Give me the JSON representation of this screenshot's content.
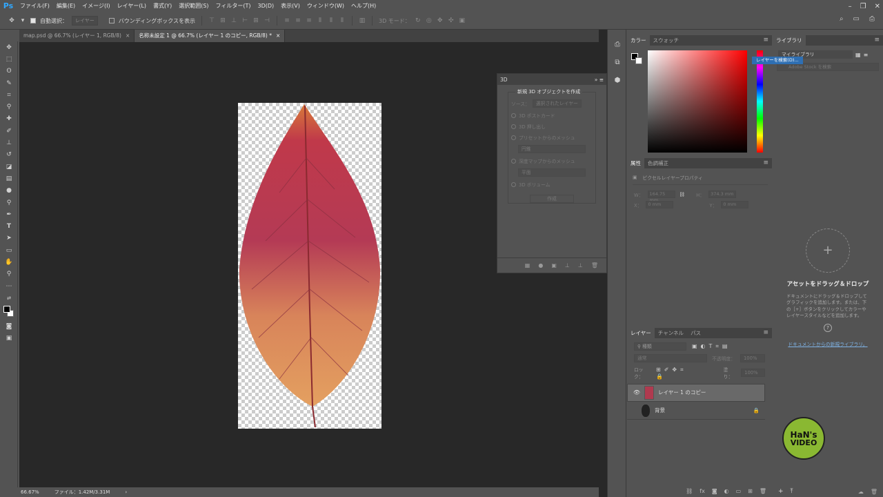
{
  "app": {
    "logo": "Ps"
  },
  "menus": [
    "ファイル(F)",
    "編集(E)",
    "イメージ(I)",
    "レイヤー(L)",
    "書式(Y)",
    "選択範囲(S)",
    "フィルター(T)",
    "3D(D)",
    "表示(V)",
    "ウィンドウ(W)",
    "ヘルプ(H)"
  ],
  "options": {
    "auto_select_label": "自動選択：",
    "auto_select_value": "レイヤー",
    "bbox_label": "バウンディングボックスを表示",
    "mode3d_label": "3D モード："
  },
  "tabs": [
    {
      "label": "map.psd @ 66.7% (レイヤー 1, RGB/8)",
      "close": "×"
    },
    {
      "label": "名称未設定 1 @ 66.7% (レイヤー 1 のコピー, RGB/8) *",
      "close": "×"
    }
  ],
  "status": {
    "zoom": "66.67%",
    "file": "ファイル：1.42M/3.31M",
    "arrow": "›"
  },
  "panel3d": {
    "title": "3D",
    "heading": "新規 3D オブジェクトを作成",
    "source_label": "ソース：",
    "source_value": "選択されたレイヤー",
    "opt1": "3D ポストカード",
    "opt2": "3D 押し出し",
    "opt3": "プリセットからのメッシュ",
    "opt3_value": "円錐",
    "opt4": "深度マップからのメッシュ",
    "opt4_value": "平面",
    "opt5": "3D ボリューム",
    "create": "作成"
  },
  "color_panel": {
    "tab_color": "カラー",
    "tab_swatch": "スウォッチ",
    "fg_color": "#000000",
    "bg_color": "#ffffff",
    "hue_color": "#ff0000"
  },
  "props_panel": {
    "tab_props": "属性",
    "tab_adjust": "色調補正",
    "title": "ピクセルレイヤープロパティ",
    "w_label": "W：",
    "w_value": "164.75 mm",
    "h_label": "H：",
    "h_value": "374.3 mm",
    "x_label": "X：",
    "x_value": "0 mm",
    "y_label": "Y：",
    "y_value": "0 mm"
  },
  "layers_panel": {
    "tab_layers": "レイヤー",
    "tab_channels": "チャンネル",
    "tab_paths": "パス",
    "kind": "種類",
    "blend": "通常",
    "opacity_label": "不透明度：",
    "opacity_value": "100%",
    "lock_label": "ロック：",
    "fill_label": "塗り：",
    "fill_value": "100%",
    "layers": [
      {
        "name": "レイヤー 1 のコピー",
        "visible": true,
        "selected": true
      },
      {
        "name": "背景",
        "visible": false,
        "selected": false
      }
    ]
  },
  "library": {
    "tab": "ライブラリ",
    "my_library": "マイライブラリ",
    "tooltip": "レイヤーを検索(D)...",
    "search_placeholder": "Adobe Stock を検索",
    "drop_title": "アセットをドラッグ＆ドロップ",
    "drop_text": "ドキュメントにドラッグ＆ドロップしてグラフィックを追加します。または、下の［+］ボタンをクリックしてカラーやレイヤースタイルなどを追加します。",
    "new_library": "ドキュメントからの新規ライブラリ。",
    "plus": "+",
    "help": "?"
  },
  "watermark": {
    "line1": "HaN's",
    "line2": "VIDEO"
  }
}
